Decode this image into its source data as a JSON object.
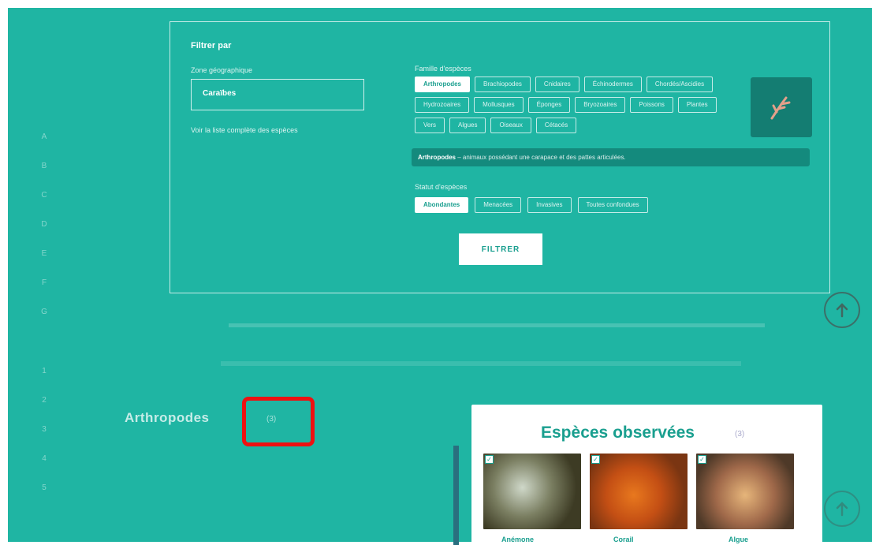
{
  "filter": {
    "title": "Filtrer par",
    "zone_label": "Zone géographique",
    "zone_value": "Caraïbes",
    "zone_link": "Voir la liste complète des espèces",
    "famille_label": "Famille d'espèces",
    "familles": [
      {
        "label": "Arthropodes",
        "active": true
      },
      {
        "label": "Brachiopodes",
        "active": false
      },
      {
        "label": "Cnidaires",
        "active": false
      },
      {
        "label": "Échinodermes",
        "active": false
      },
      {
        "label": "Chordés/Ascidies",
        "active": false
      },
      {
        "label": "Hydrozoaires",
        "active": false
      },
      {
        "label": "Mollusques",
        "active": false
      },
      {
        "label": "Éponges",
        "active": false
      },
      {
        "label": "Bryozoaires",
        "active": false
      },
      {
        "label": "Poissons",
        "active": false
      },
      {
        "label": "Plantes",
        "active": false
      },
      {
        "label": "Vers",
        "active": false
      },
      {
        "label": "Algues",
        "active": false
      },
      {
        "label": "Oiseaux",
        "active": false
      },
      {
        "label": "Cétacés",
        "active": false
      }
    ],
    "description_name": "Arthropodes",
    "description_text": " – animaux possédant une carapace et des pattes articulées.",
    "statut_label": "Statut d'espèces",
    "statuts": [
      {
        "label": "Abondantes",
        "active": true
      },
      {
        "label": "Menacées",
        "active": false
      },
      {
        "label": "Invasives",
        "active": false
      },
      {
        "label": "Toutes confondues",
        "active": false
      }
    ],
    "button_label": "FILTRER"
  },
  "results": {
    "section_title": "Arthropodes",
    "section_count": "(3)",
    "card_title": "Espèces observées",
    "card_count": "(3)",
    "species": [
      {
        "name": "Anémone"
      },
      {
        "name": "Corail"
      },
      {
        "name": "Algue"
      }
    ]
  },
  "side_nav": [
    "A",
    "B",
    "C",
    "D",
    "E",
    "F",
    "G"
  ],
  "side_nav_lower": [
    "1",
    "2",
    "3",
    "4",
    "5"
  ]
}
